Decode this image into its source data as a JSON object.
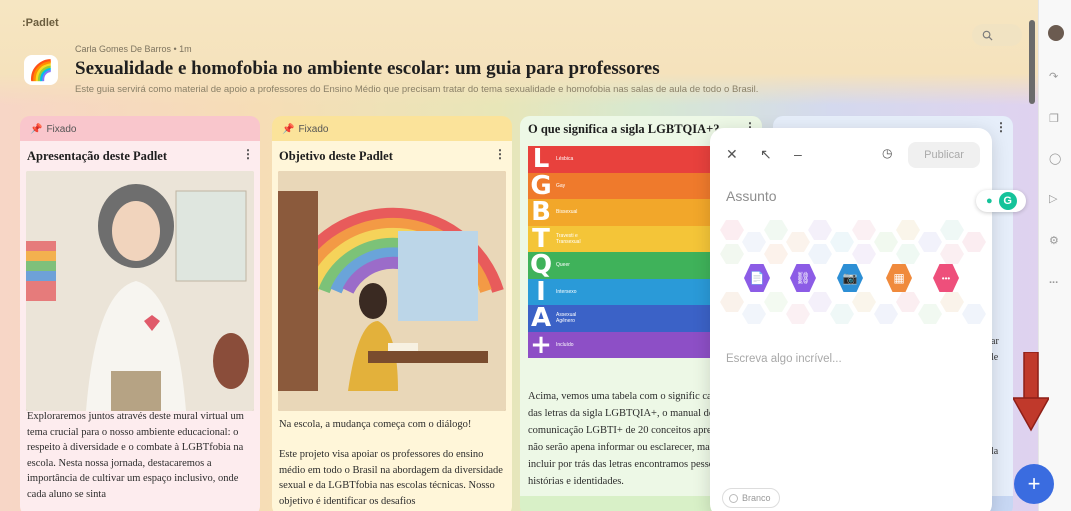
{
  "app": {
    "logo": ":Padlet"
  },
  "header": {
    "author": "Carla Gomes De Barros • 1m",
    "board_emoji": "🌈",
    "title": "Sexualidade e homofobia no ambiente escolar: um guia para professores",
    "subtitle": "Este guia servirá como material de apoio a professores do Ensino Médio que precisam tratar do tema sexualidade e homofobia nas salas de aula de todo o Brasil."
  },
  "columns": [
    {
      "pinned_label": "Fixado",
      "card_title": "Apresentação deste Padlet",
      "body": "Exploraremos juntos através deste mural virtual um tema crucial para o nosso ambiente educacional: o respeito à diversidade e o combate à LGBTfobia na escola. Nesta nossa jornada, destacaremos a importância de cultivar um espaço inclusivo, onde cada aluno se sinta"
    },
    {
      "pinned_label": "Fixado",
      "card_title": "Objetivo deste Padlet",
      "body_1": "Na escola, a mudança começa com o diálogo!",
      "body_2": "Este projeto visa apoiar os professores do ensino médio em todo o Brasil na abordagem da diversidade sexual e da LGBTfobia nas escolas técnicas. Nosso objetivo é identificar os desafios"
    },
    {
      "card_title": "O que significa a sigla LGBTQIA+?",
      "lgbt_rows": [
        {
          "letter": "L",
          "word": "Lésbica",
          "color": "#e8413d"
        },
        {
          "letter": "G",
          "word": "Gay",
          "color": "#ef7a2c"
        },
        {
          "letter": "B",
          "word": "Bissexual",
          "color": "#f2a72a"
        },
        {
          "letter": "T",
          "word": "Travesti e Transexual",
          "color": "#f4c538"
        },
        {
          "letter": "Q",
          "word": "Queer",
          "color": "#3fb25a"
        },
        {
          "letter": "I",
          "word": "Intersexo",
          "color": "#2a9ad8"
        },
        {
          "letter": "A",
          "word": "Assexual Agênero",
          "color": "#3b62c7"
        },
        {
          "letter": "+",
          "word": "Incluído",
          "color": "#8d4fc6"
        }
      ],
      "body": "Acima, vemos uma tabela com o signific cada uma das letras da sigla LGBTQIA+, o manual de comunicação LGBTI+ de 20 conceitos apresentados não serão apena informar ou esclarecer, mas para incluir por trás das letras encontramos pessoas histórias e identidades."
    },
    {
      "fragments": [
        "ar",
        "le",
        "la"
      ]
    }
  ],
  "composer": {
    "close": "✕",
    "expand": "↖",
    "minimize": "–",
    "publish_label": "Publicar",
    "subject_placeholder": "Assunto",
    "body_placeholder": "Escreva algo incrível...",
    "color_label": "Branco",
    "attachments": [
      {
        "icon": "file-icon",
        "glyph": "📄",
        "color": "#8c5ce6"
      },
      {
        "icon": "link-icon",
        "glyph": "⛓",
        "color": "#8c5ce6"
      },
      {
        "icon": "camera-icon",
        "glyph": "📷",
        "color": "#2d8fd5"
      },
      {
        "icon": "image-search-icon",
        "glyph": "▦",
        "color": "#f08a3c"
      },
      {
        "icon": "more-icon",
        "glyph": "•••",
        "color": "#ee4f7b"
      }
    ]
  },
  "grammarly": {
    "letter": "G"
  },
  "fab": {
    "label": "+"
  },
  "rail": {
    "more": "..."
  }
}
